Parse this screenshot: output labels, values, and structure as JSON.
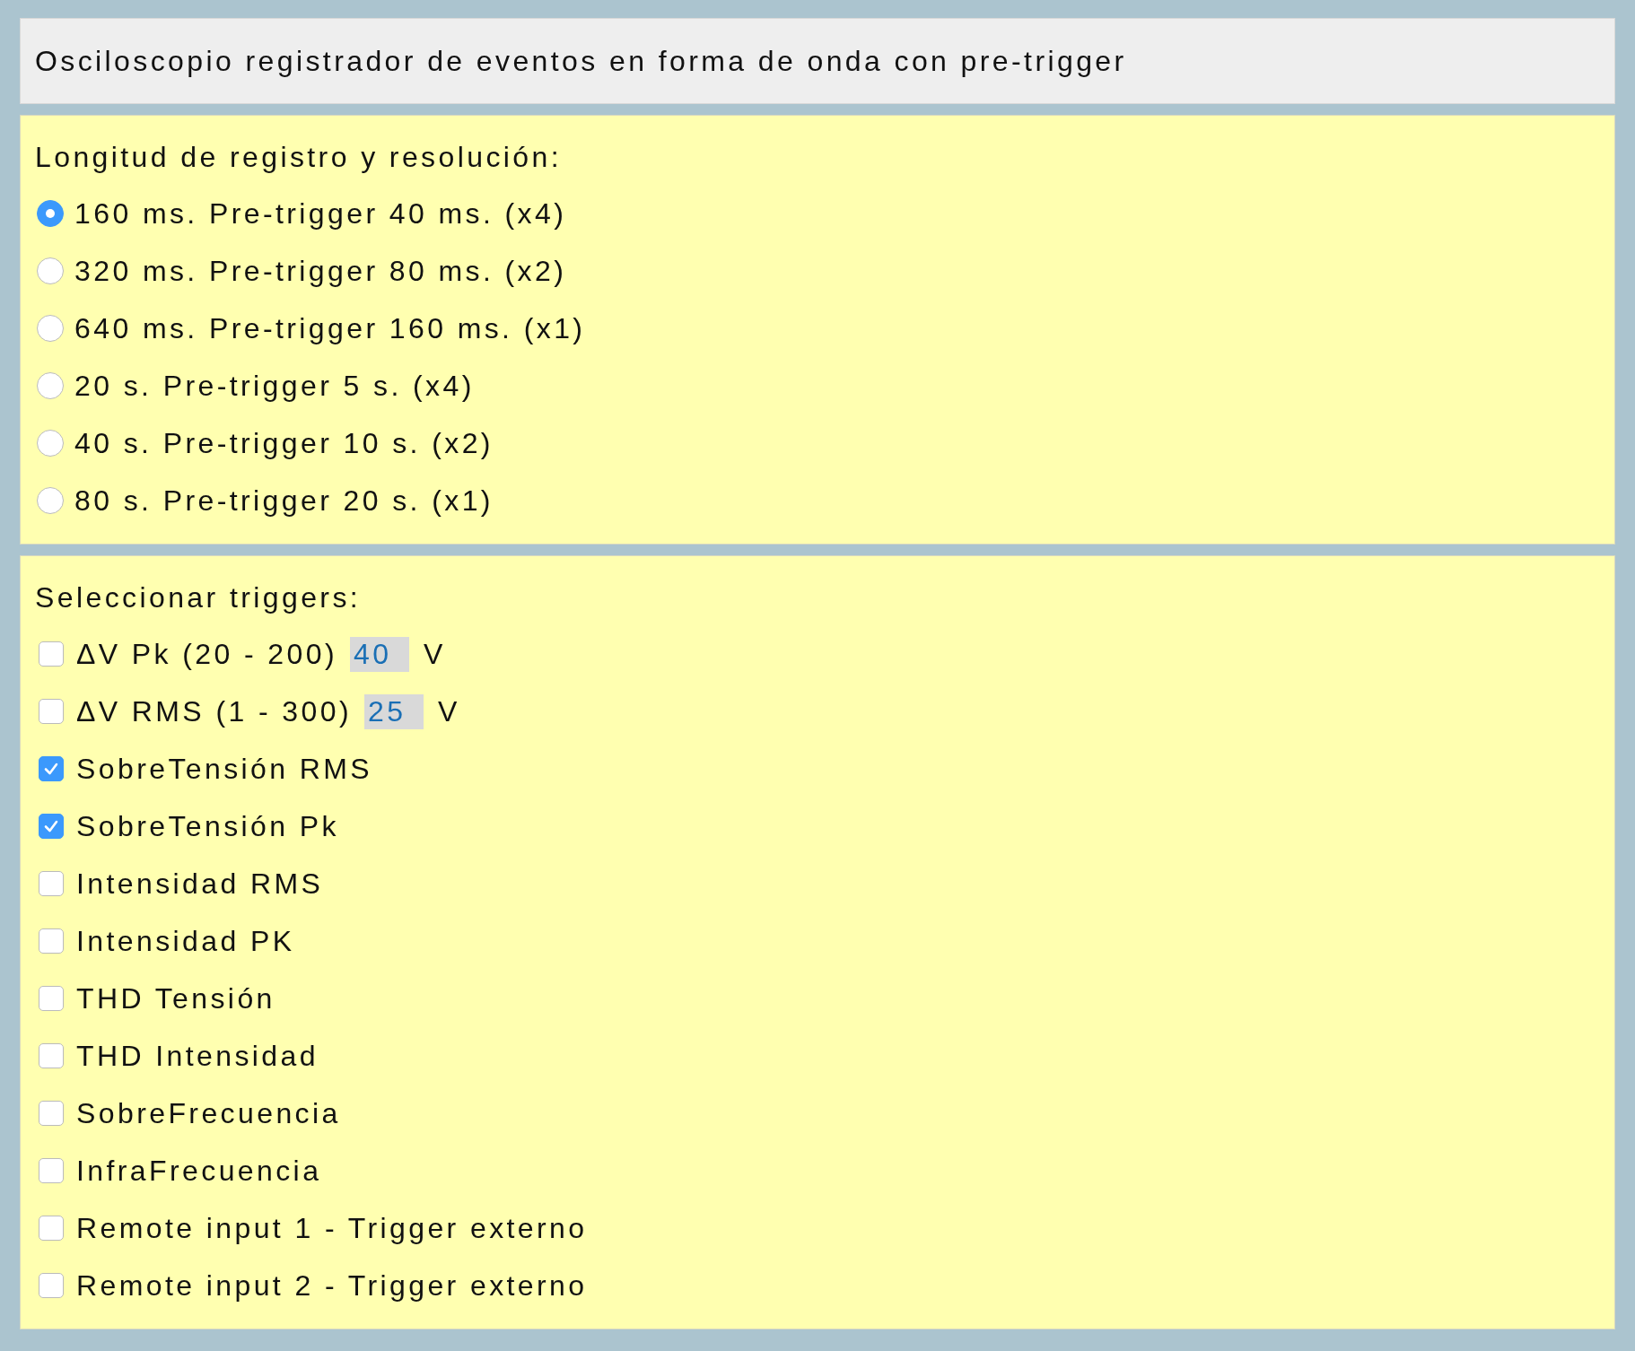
{
  "header": {
    "title": "Osciloscopio registrador de eventos en forma de onda con pre-trigger"
  },
  "resolution": {
    "title": "Longitud de registro y resolución:",
    "options": [
      {
        "label": "160 ms. Pre-trigger 40 ms. (x4)",
        "selected": true
      },
      {
        "label": "320 ms. Pre-trigger 80 ms. (x2)",
        "selected": false
      },
      {
        "label": "640 ms. Pre-trigger 160 ms. (x1)",
        "selected": false
      },
      {
        "label": "20 s. Pre-trigger 5 s. (x4)",
        "selected": false
      },
      {
        "label": "40 s. Pre-trigger 10 s. (x2)",
        "selected": false
      },
      {
        "label": "80 s. Pre-trigger 20 s. (x1)",
        "selected": false
      }
    ]
  },
  "triggers": {
    "title": "Seleccionar triggers:",
    "items": [
      {
        "kind": "field",
        "label": "ΔV Pk (20 - 200)",
        "value": "40",
        "unit": "V",
        "checked": false
      },
      {
        "kind": "field",
        "label": "ΔV RMS (1 - 300)",
        "value": "25",
        "unit": "V",
        "checked": false
      },
      {
        "kind": "plain",
        "label": "SobreTensión RMS",
        "checked": true
      },
      {
        "kind": "plain",
        "label": "SobreTensión Pk",
        "checked": true
      },
      {
        "kind": "plain",
        "label": "Intensidad RMS",
        "checked": false
      },
      {
        "kind": "plain",
        "label": "Intensidad PK",
        "checked": false
      },
      {
        "kind": "plain",
        "label": "THD Tensión",
        "checked": false
      },
      {
        "kind": "plain",
        "label": "THD Intensidad",
        "checked": false
      },
      {
        "kind": "plain",
        "label": "SobreFrecuencia",
        "checked": false
      },
      {
        "kind": "plain",
        "label": "InfraFrecuencia",
        "checked": false
      },
      {
        "kind": "plain",
        "label": "Remote input 1 - Trigger externo",
        "checked": false
      },
      {
        "kind": "plain",
        "label": "Remote input 2 - Trigger externo",
        "checked": false
      }
    ]
  }
}
